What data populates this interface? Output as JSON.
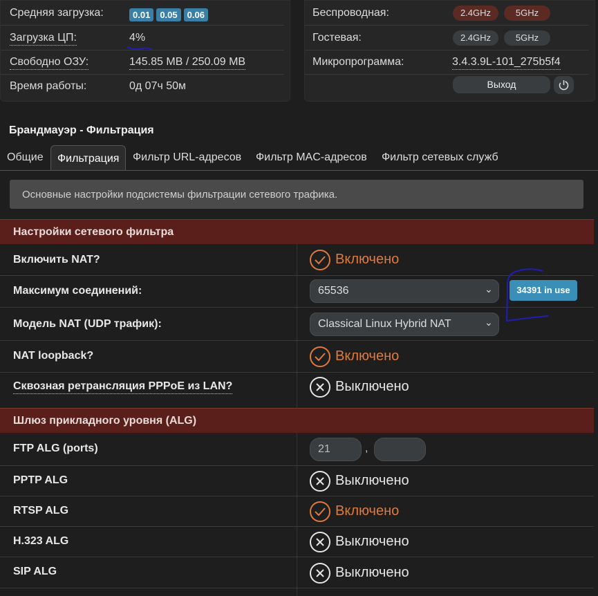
{
  "status_left": {
    "rows": [
      {
        "label": "Средняя загрузка:",
        "badges": [
          "0.01",
          "0.05",
          "0.06"
        ]
      },
      {
        "label": "Загрузка ЦП:",
        "value": "4%"
      },
      {
        "label": "Свободно ОЗУ:",
        "value": "145.85 MB / 250.09 MB"
      },
      {
        "label": "Время работы:",
        "value": "0д 07ч 50м"
      }
    ]
  },
  "status_right": {
    "rows": [
      {
        "label": "Беспроводная:",
        "bands": [
          "2.4GHz",
          "5GHz"
        ]
      },
      {
        "label": "Гостевая:",
        "bands": [
          "2.4GHz",
          "5GHz"
        ]
      },
      {
        "label": "Микропрограмма:",
        "value": "3.4.3.9L-101_275b5f4"
      }
    ],
    "logout_label": "Выход"
  },
  "page_title": "Брандмауэр - Фильтрация",
  "tabs": [
    "Общие",
    "Фильтрация",
    "Фильтр URL-адресов",
    "Фильтр MAC-адресов",
    "Фильтр сетевых служб"
  ],
  "active_tab_index": 1,
  "info_text": "Основные настройки подсистемы фильтрации сетевого трафика.",
  "section_filter": {
    "title": "Настройки сетевого фильтра",
    "nat_label": "Включить NAT?",
    "nat_state": "Включено",
    "max_conn_label": "Максимум соединений:",
    "max_conn_value": "65536",
    "in_use_badge": "34391 in use",
    "nat_model_label": "Модель NAT (UDP трафик):",
    "nat_model_value": "Classical Linux Hybrid NAT",
    "loopback_label": "NAT loopback?",
    "loopback_state": "Включено",
    "pppoe_label": "Сквозная ретрансляция PPPoE из LAN?",
    "pppoe_state": "Выключено"
  },
  "section_alg": {
    "title": "Шлюз прикладного уровня (ALG)",
    "ftp_label": "FTP ALG (ports)",
    "ftp_port1": "21",
    "ftp_separator": ",",
    "ftp_port2": "",
    "pptp_label": "PPTP ALG",
    "pptp_state": "Выключено",
    "rtsp_label": "RTSP ALG",
    "rtsp_state": "Включено",
    "h323_label": "H.323 ALG",
    "h323_state": "Выключено",
    "sip_label": "SIP ALG",
    "sip_state": "Выключено"
  },
  "colors": {
    "background": "#1e1e1e",
    "section_header": "#5a1f1a",
    "enabled": "#e07a3c",
    "badge_blue": "#3a8fb8",
    "annotation_pen": "#1e1eb4"
  }
}
